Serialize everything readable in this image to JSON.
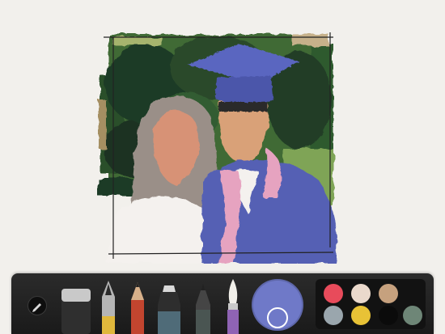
{
  "app": {
    "canvas_background": "#f2f0ec"
  },
  "artwork": {
    "description_icon": "watercolor-graduation-portrait",
    "colors": {
      "foliage_dark": "#1f3a26",
      "foliage_mid": "#3f6a36",
      "foliage_light": "#7fa457",
      "cap_gown": "#5460b4",
      "skin": "#d79276",
      "hair": "#9a8f88",
      "lei": "#e6a3c0",
      "shirt": "#f4f1ee"
    }
  },
  "toolbar": {
    "edit_icon": "pencil-icon",
    "tools": [
      {
        "name": "eraser",
        "icon": "eraser-icon",
        "color": "#c9c9c9"
      },
      {
        "name": "fountain-pen",
        "icon": "fountain-pen-icon",
        "color": "#e0b83c"
      },
      {
        "name": "pencil",
        "icon": "pencil-tool-icon",
        "color": "#c2452f"
      },
      {
        "name": "marker",
        "icon": "marker-icon",
        "color": "#4f6b78"
      },
      {
        "name": "thin-marker",
        "icon": "thin-marker-icon",
        "color": "#4a5552"
      },
      {
        "name": "brush",
        "icon": "brush-icon",
        "color": "#8f63b4"
      }
    ],
    "current_color": "#6f79c8",
    "swatches": [
      "#e84b5b",
      "#ead9cc",
      "#c6a17e",
      "#9aa6ad",
      "#e8c236",
      "#0b0b0b",
      "#6e8677"
    ]
  }
}
